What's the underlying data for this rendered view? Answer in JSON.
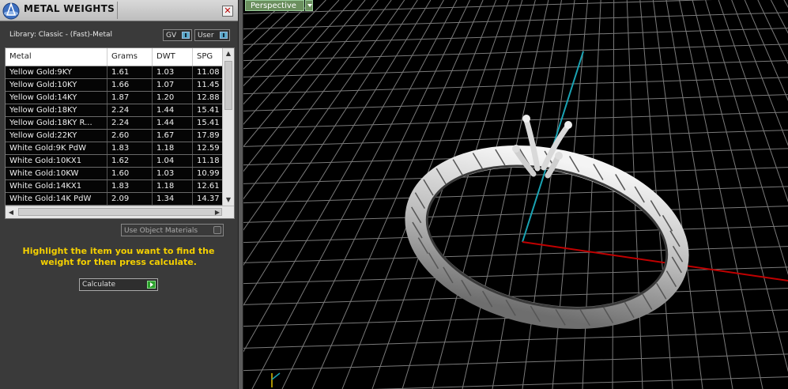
{
  "panel": {
    "title": "METAL WEIGHTS",
    "library_label": "Library: Classic - (Fast)-Metal",
    "toggle_gv": "GV",
    "toggle_user": "User",
    "columns": [
      "Metal",
      "Grams",
      "DWT",
      "SPG"
    ],
    "rows": [
      [
        "Yellow Gold:9KY",
        "1.61",
        "1.03",
        "11.08"
      ],
      [
        "Yellow Gold:10KY",
        "1.66",
        "1.07",
        "11.45"
      ],
      [
        "Yellow Gold:14KY",
        "1.87",
        "1.20",
        "12.88"
      ],
      [
        "Yellow Gold:18KY",
        "2.24",
        "1.44",
        "15.41"
      ],
      [
        "Yellow Gold:18KY R...",
        "2.24",
        "1.44",
        "15.41"
      ],
      [
        "Yellow Gold:22KY",
        "2.60",
        "1.67",
        "17.89"
      ],
      [
        "White Gold:9K PdW",
        "1.83",
        "1.18",
        "12.59"
      ],
      [
        "White Gold:10KX1",
        "1.62",
        "1.04",
        "11.18"
      ],
      [
        "White Gold:10KW",
        "1.60",
        "1.03",
        "10.99"
      ],
      [
        "White Gold:14KX1",
        "1.83",
        "1.18",
        "12.61"
      ],
      [
        "White Gold:14K PdW",
        "2.09",
        "1.34",
        "14.37"
      ]
    ],
    "use_object_materials": "Use Object Materials",
    "hint": "Highlight the item you want to find the weight for then press calculate.",
    "calculate_label": "Calculate"
  },
  "viewport": {
    "label": "Perspective",
    "axis_x_color": "#c00000",
    "axis_y_color": "#1aa3b3",
    "grid_color": "#7a7a7a"
  }
}
